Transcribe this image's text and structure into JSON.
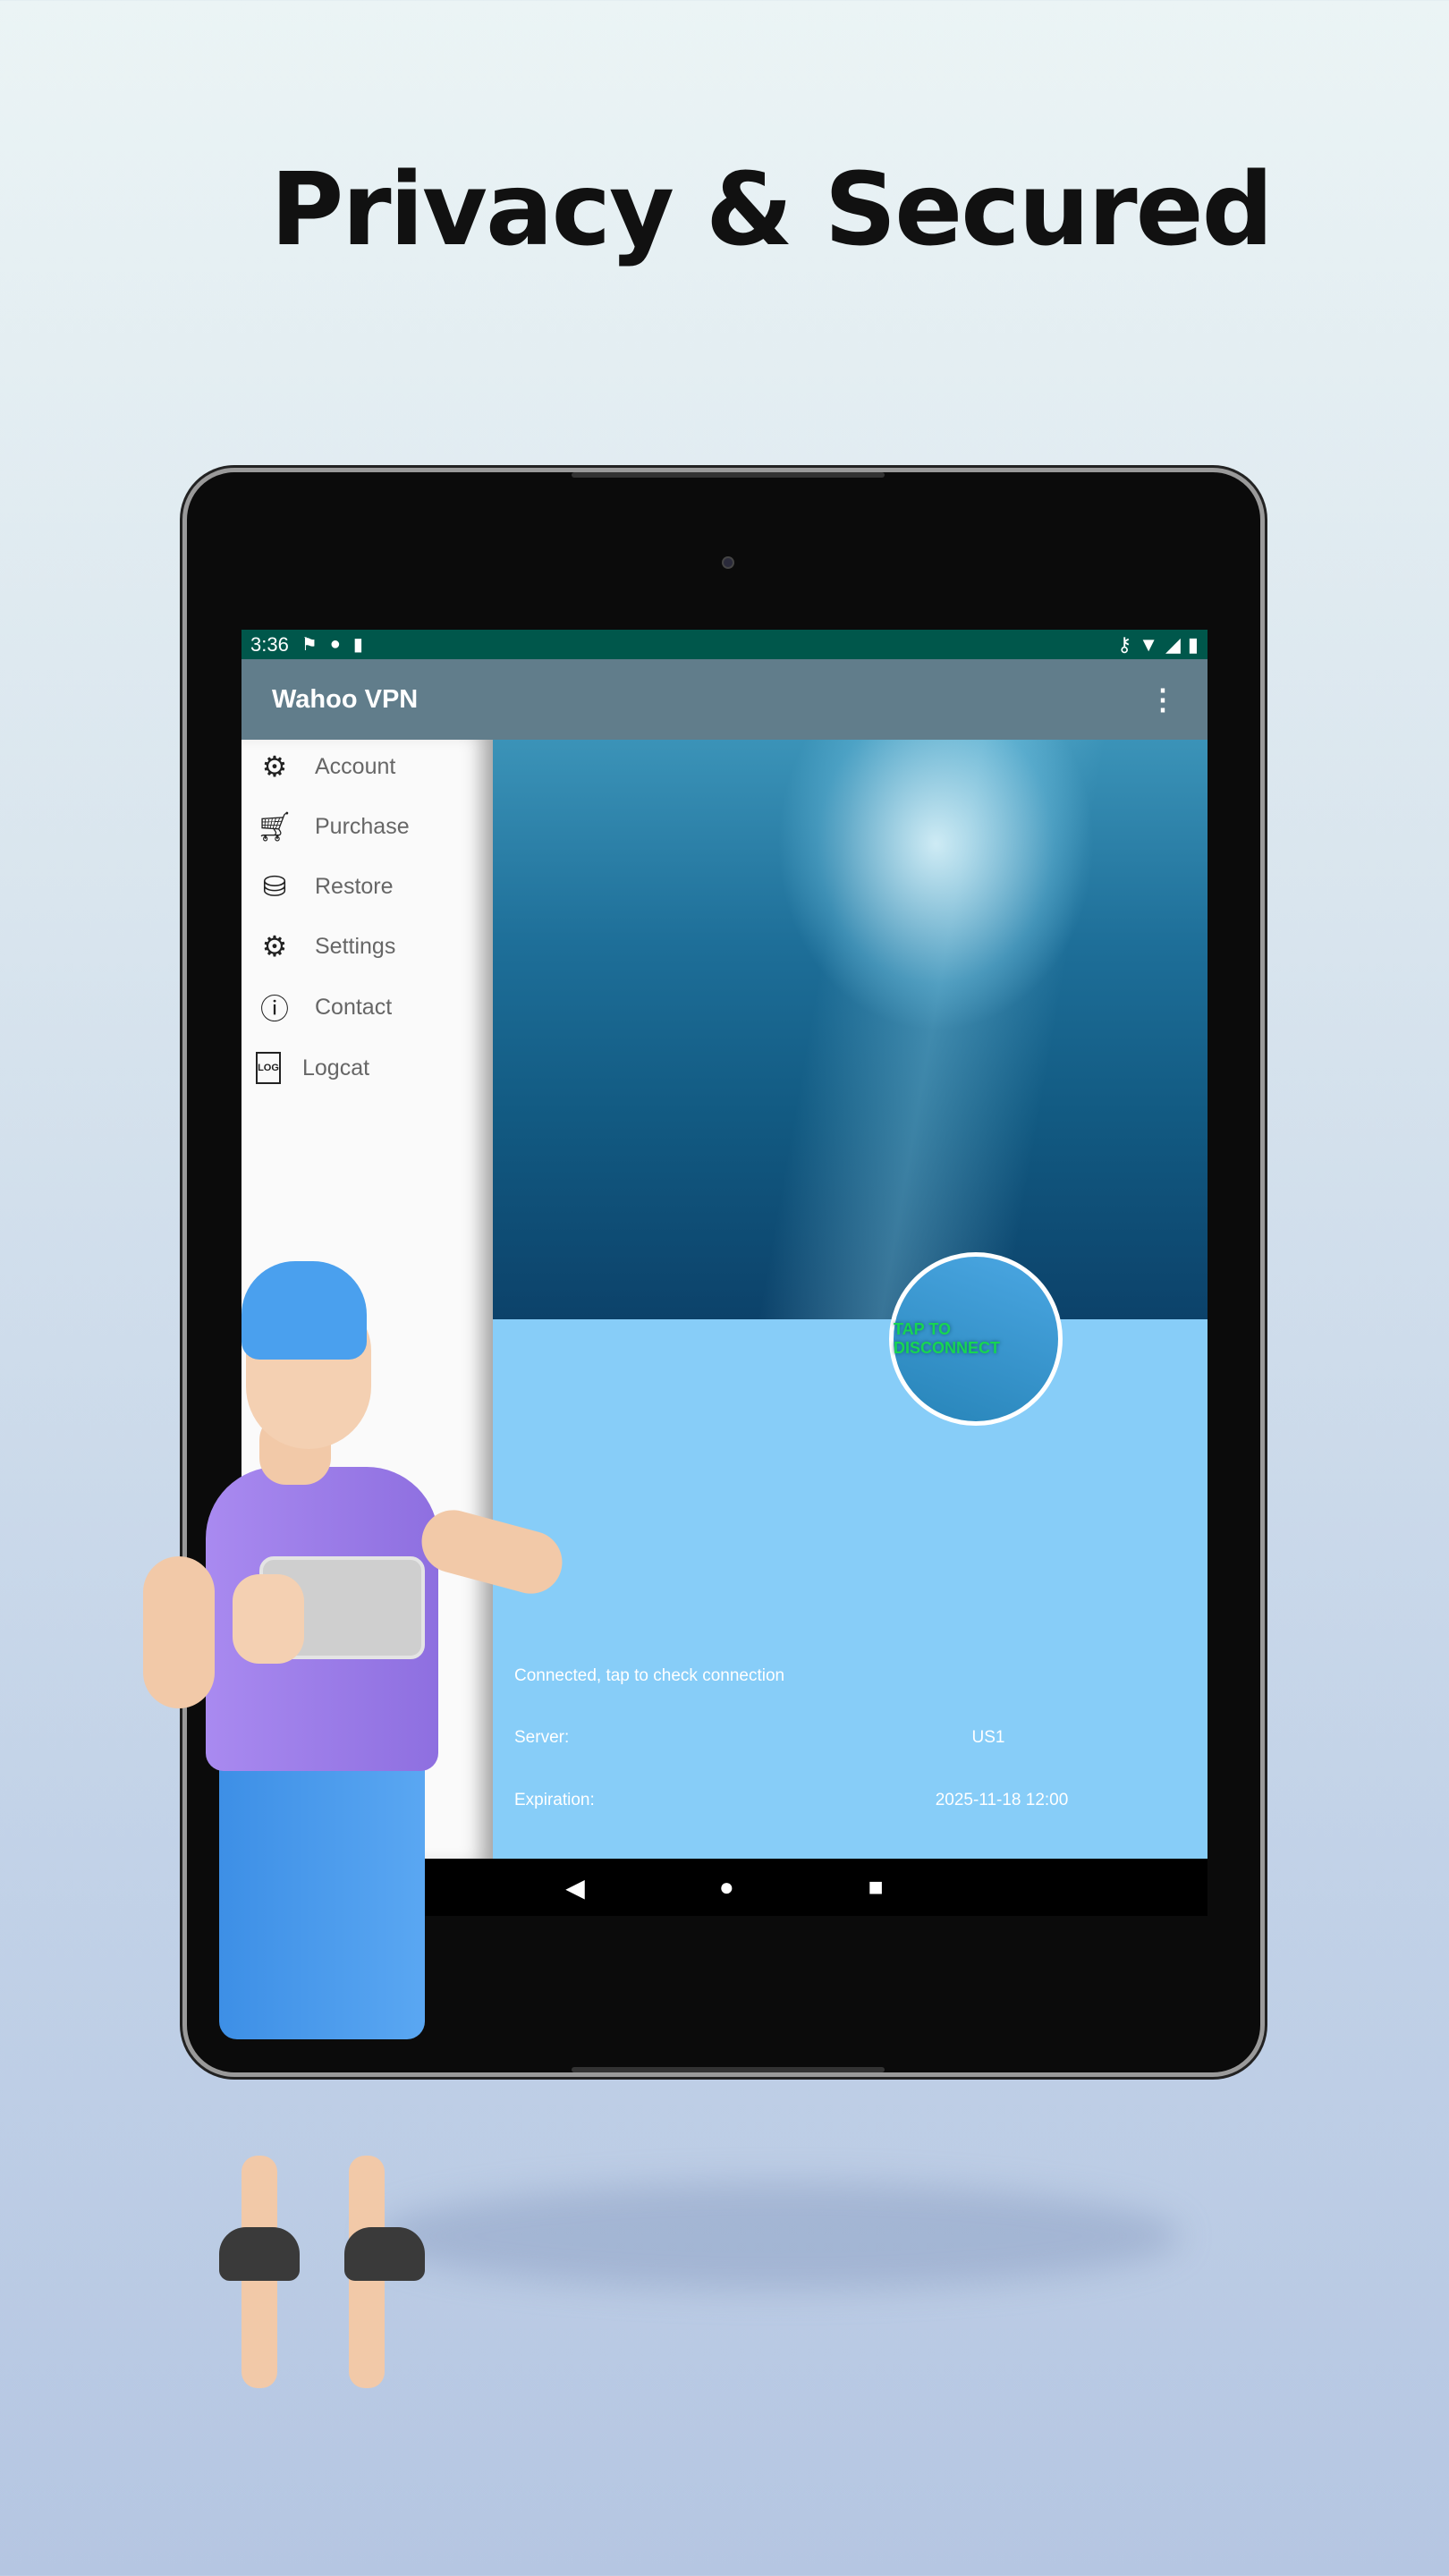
{
  "headline": "Privacy & Secured",
  "status_bar": {
    "time": "3:36",
    "left_icons": [
      "notification-icon",
      "app-icon",
      "sd-card-icon"
    ],
    "right_icons": [
      "vpn-key-icon",
      "wifi-icon",
      "signal-icon",
      "battery-icon"
    ]
  },
  "app_bar": {
    "title": "Wahoo VPN",
    "menu_icon": "more-vertical-icon"
  },
  "sidebar": {
    "items": [
      {
        "label": "Account",
        "icon": "gear-icon"
      },
      {
        "label": "Purchase",
        "icon": "cart-icon"
      },
      {
        "label": "Restore",
        "icon": "database-restore-icon"
      },
      {
        "label": "Settings",
        "icon": "gear-icon"
      },
      {
        "label": "Contact",
        "icon": "info-bubble-icon"
      },
      {
        "label": "Logcat",
        "icon": "log-file-icon"
      }
    ]
  },
  "main": {
    "button_label": "TAP TO DISCONNECT",
    "status_text": "Connected, tap to check connection",
    "server_label": "Server:",
    "server_value": "US1",
    "expiration_label": "Expiration:",
    "expiration_value": "2025-11-18 12:00"
  },
  "colors": {
    "status_bar": "#00574b",
    "app_bar": "#617d8b",
    "lower_panel": "#87cdf8",
    "button_text": "#17d552"
  },
  "nav_bar": {
    "icons": [
      "back-icon",
      "home-icon",
      "recents-icon"
    ]
  }
}
